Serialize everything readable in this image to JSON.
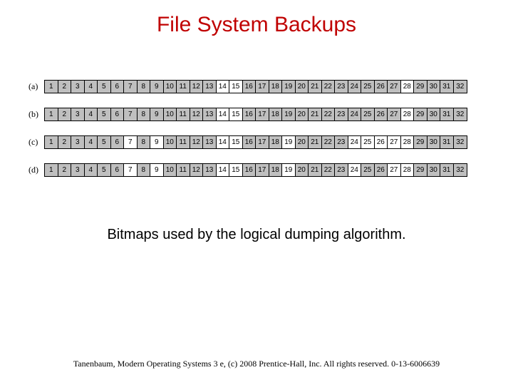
{
  "title": "File System Backups",
  "caption": "Bitmaps used by the logical dumping algorithm.",
  "footer": "Tanenbaum, Modern Operating Systems 3 e, (c) 2008 Prentice-Hall, Inc. All rights reserved. 0-13-6006639",
  "chart_data": {
    "type": "table",
    "title": "Bitmaps used by the logical dumping algorithm.",
    "num_cells": 32,
    "rows": [
      {
        "label": "(a)",
        "shaded": [
          1,
          2,
          3,
          4,
          5,
          6,
          7,
          8,
          9,
          10,
          11,
          12,
          13,
          16,
          17,
          18,
          19,
          20,
          21,
          22,
          23,
          24,
          25,
          26,
          27,
          29,
          30,
          31,
          32
        ]
      },
      {
        "label": "(b)",
        "shaded": [
          1,
          2,
          3,
          4,
          5,
          6,
          7,
          8,
          9,
          10,
          11,
          12,
          13,
          16,
          17,
          18,
          19,
          20,
          21,
          22,
          23,
          24,
          25,
          26,
          27,
          29,
          30,
          31,
          32
        ]
      },
      {
        "label": "(c)",
        "shaded": [
          1,
          2,
          3,
          4,
          5,
          6,
          8,
          10,
          11,
          12,
          13,
          16,
          17,
          18,
          20,
          21,
          22,
          23,
          29,
          30,
          31,
          32
        ]
      },
      {
        "label": "(d)",
        "shaded": [
          1,
          2,
          3,
          4,
          5,
          6,
          8,
          10,
          11,
          12,
          13,
          16,
          17,
          18,
          20,
          21,
          22,
          23,
          25,
          26,
          29,
          30,
          31,
          32
        ]
      }
    ]
  }
}
